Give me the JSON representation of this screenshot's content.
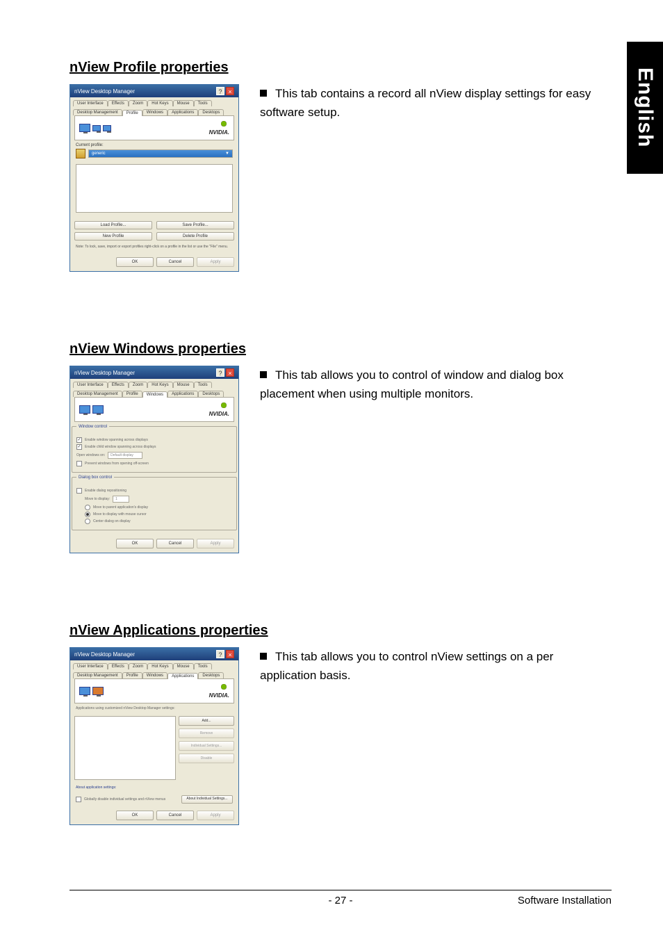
{
  "language_tab": "English",
  "footer": {
    "page": "- 27 -",
    "section": "Software Installation"
  },
  "common": {
    "dialog_title": "nView Desktop Manager",
    "help_glyph": "?",
    "close_glyph": "×",
    "brand": "NVIDIA.",
    "tabs_top": [
      "User Interface",
      "Effects",
      "Zoom",
      "Hot Keys",
      "Mouse",
      "Tools"
    ],
    "tabs_bottom": [
      "Desktop Management",
      "Profile",
      "Windows",
      "Applications",
      "Desktops"
    ],
    "ok": "OK",
    "cancel": "Cancel",
    "apply": "Apply"
  },
  "profile": {
    "heading": "nView Profile properties",
    "desc": "This tab contains a record all nView display settings for easy software setup.",
    "active_tab_index": 1,
    "current_label": "Current profile:",
    "current_value": "generic",
    "buttons": {
      "load": "Load Profile...",
      "save": "Save Profile...",
      "new": "New Profile",
      "delete": "Delete Profile"
    },
    "note": "Note: To lock, save, import or export profiles right-click on a profile in the list or use the \"File\" menu."
  },
  "windows": {
    "heading": "nView Windows properties",
    "desc": "This tab allows you to control of window and dialog box placement when using multiple monitors.",
    "active_tab_index": 2,
    "window_group": "Window control",
    "chk1": "Enable window spanning across displays",
    "chk2": "Enable child window spanning across displays",
    "open_label": "Open windows on:",
    "open_value": "Default display",
    "prevent": "Prevent windows from opening off-screen",
    "dialog_group": "Dialog box control",
    "rad1": "Enable dialog repositioning",
    "move_label": "Move to display:",
    "move_value": "1",
    "rad3": "Move to parent application's display",
    "rad4": "Move to display with mouse cursor",
    "rad5": "Center dialog on display"
  },
  "applications": {
    "heading": "nView Applications properties",
    "desc": "This tab allows you to control nView settings on a per application basis.",
    "active_tab_index": 3,
    "list_label": "Applications using customized nView Desktop Manager settings:",
    "buttons": {
      "add": "Add...",
      "remove": "Remove",
      "individual": "Individual Settings...",
      "disable": "Disable"
    },
    "comment_label": "About application settings:",
    "global_chk": "Globally disable individual settings and nView menus",
    "global_btn": "About Individual Settings..."
  }
}
